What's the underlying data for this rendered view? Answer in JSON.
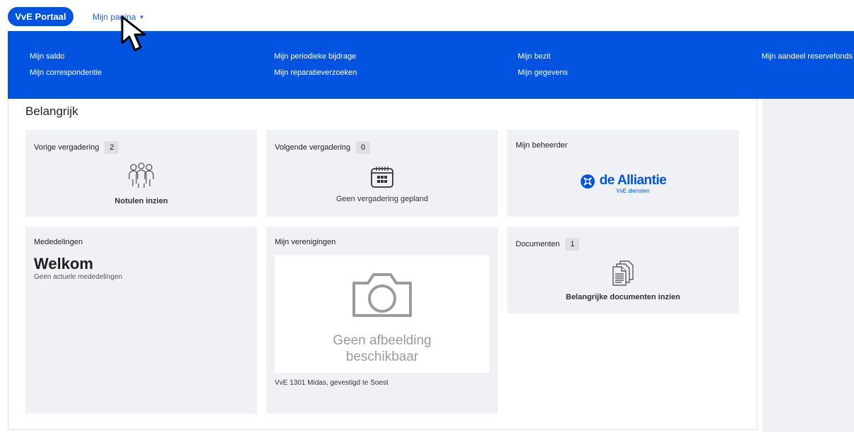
{
  "topbar": {
    "brand_label": "VvE Portaal",
    "menu_label": "Mijn pagina"
  },
  "dropdown": {
    "items": [
      {
        "label": "Mijn saldo"
      },
      {
        "label": "Mijn correspondentie"
      },
      {
        "label": "Mijn periodieke bijdrage"
      },
      {
        "label": "Mijn reparatieverzoeken"
      },
      {
        "label": "Mijn bezit"
      },
      {
        "label": "Mijn gegevens"
      },
      {
        "label": "Mijn aandeel reservefonds"
      }
    ]
  },
  "main": {
    "section_title": "Belangrijk",
    "cards": {
      "previous_meeting": {
        "title": "Vorige vergadering",
        "count": "2",
        "caption": "Notulen inzien",
        "icon": "people-group-icon"
      },
      "next_meeting": {
        "title": "Volgende vergadering",
        "count": "0",
        "caption": "Geen vergadering gepland",
        "icon": "calendar-icon"
      },
      "manager": {
        "title": "Mijn beheerder",
        "logo_main": "de Alliantie",
        "logo_sub": "VvE diensten",
        "icon": "alliantie-logo-icon"
      },
      "announcements": {
        "title": "Mededelingen",
        "heading": "Welkom",
        "text": "Geen actuele mededelingen"
      },
      "associations": {
        "title": "Mijn verenigingen",
        "placeholder_line1": "Geen afbeelding",
        "placeholder_line2": "beschikbaar",
        "caption": "VvE 1301 Midas, gevestigd te Soest",
        "icon": "camera-icon"
      },
      "documents": {
        "title": "Documenten",
        "count": "1",
        "caption": "Belangrijke documenten inzien",
        "icon": "documents-icon"
      }
    }
  },
  "colors": {
    "brand": "#0254e0",
    "card_bg": "#eff1f4",
    "badge_bg": "#dde0e5"
  }
}
